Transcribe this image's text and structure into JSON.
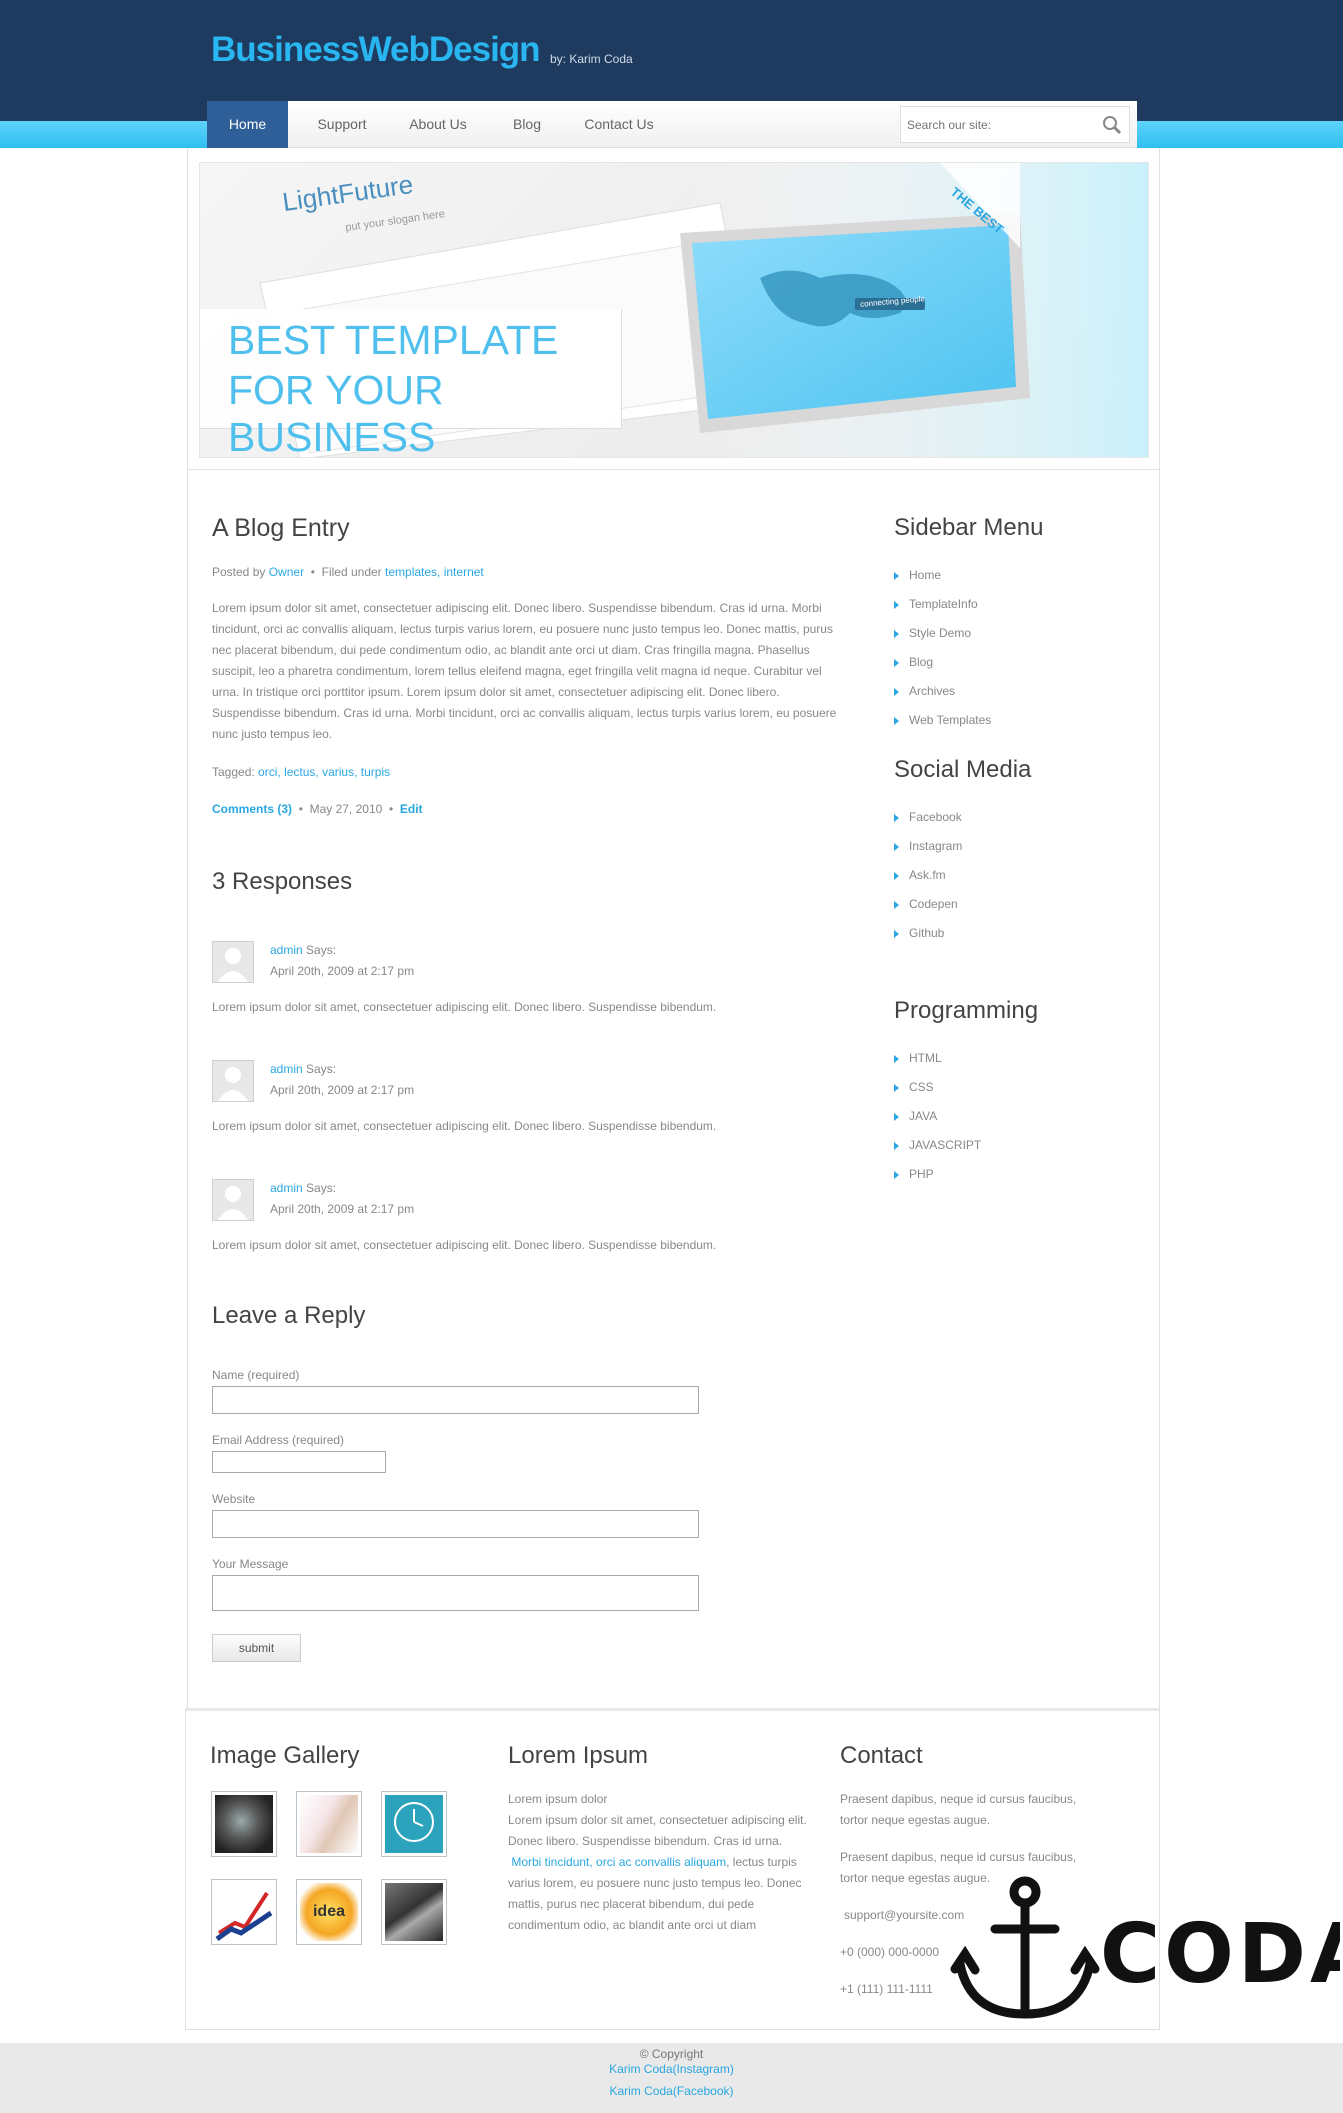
{
  "header": {
    "logo": "BusinessWebDesign",
    "byline": "by: Karim Coda"
  },
  "nav": {
    "items": [
      "Home",
      "Support",
      "About Us",
      "Blog",
      "Contact Us"
    ],
    "search_placeholder": "Search our site:"
  },
  "banner": {
    "brand": "LightFuture",
    "slogan": "put your slogan here",
    "headline_line1": "BEST TEMPLATE",
    "headline_line2": "FOR YOUR BUSINESS",
    "ribbon": "THE BEST",
    "screen_label": "connecting people"
  },
  "post": {
    "title": "A Blog Entry",
    "posted_by": "Posted by",
    "author": "Owner",
    "filed_under": "Filed under",
    "category1": "templates",
    "category2": "internet",
    "body": "Lorem ipsum dolor sit amet, consectetuer adipiscing elit. Donec libero. Suspendisse bibendum. Cras id urna. Morbi tincidunt, orci ac convallis aliquam, lectus turpis varius lorem, eu posuere nunc justo tempus leo. Donec mattis, purus nec placerat bibendum, dui pede condimentum odio, ac blandit ante orci ut diam. Cras fringilla magna. Phasellus suscipit, leo a pharetra condimentum, lorem tellus eleifend magna, eget fringilla velit magna id neque. Curabitur vel urna. In tristique orci porttitor ipsum. Lorem ipsum dolor sit amet, consectetuer adipiscing elit. Donec libero. Suspendisse bibendum. Cras id urna. Morbi tincidunt, orci ac convallis aliquam, lectus turpis varius lorem, eu posuere nunc justo tempus leo.",
    "tagged_label": "Tagged:",
    "tags": [
      "orci",
      "lectus",
      "varius",
      "turpis"
    ],
    "comments_link": "Comments (3)",
    "date": "May 27, 2010",
    "edit": "Edit"
  },
  "responses": {
    "title": "3 Responses",
    "items": [
      {
        "author": "admin",
        "says": "Says:",
        "date": "April 20th, 2009 at 2:17 pm",
        "text": "Lorem ipsum dolor sit amet, consectetuer adipiscing elit. Donec libero. Suspendisse bibendum."
      },
      {
        "author": "admin",
        "says": "Says:",
        "date": "April 20th, 2009 at 2:17 pm",
        "text": "Lorem ipsum dolor sit amet, consectetuer adipiscing elit. Donec libero. Suspendisse bibendum."
      },
      {
        "author": "admin",
        "says": "Says:",
        "date": "April 20th, 2009 at 2:17 pm",
        "text": "Lorem ipsum dolor sit amet, consectetuer adipiscing elit. Donec libero. Suspendisse bibendum."
      }
    ]
  },
  "reply": {
    "title": "Leave a Reply",
    "name_label": "Name (required)",
    "email_label": "Email Address (required)",
    "website_label": "Website",
    "message_label": "Your Message",
    "submit": "submit"
  },
  "sidebar": {
    "menu_title": "Sidebar Menu",
    "menu": [
      "Home",
      "TemplateInfo",
      "Style Demo",
      "Blog",
      "Archives",
      "Web Templates"
    ],
    "social_title": "Social Media",
    "social": [
      "Facebook",
      "Instagram",
      "Ask.fm",
      "Codepen",
      "Github"
    ],
    "prog_title": "Programming",
    "prog": [
      "HTML",
      "CSS",
      "JAVA",
      "JAVASCRIPT",
      "PHP"
    ]
  },
  "footer": {
    "gallery_title": "Image Gallery",
    "lorem_title": "Lorem Ipsum",
    "lorem_line1": "Lorem ipsum dolor",
    "lorem_line2": "Lorem ipsum dolor sit amet, consectetuer adipiscing elit.",
    "lorem_line3": "Donec libero. Suspendisse bibendum. Cras id urna.",
    "lorem_link": "Morbi tincidunt, orci ac convallis aliquam",
    "lorem_line4_tail": ", lectus turpis",
    "lorem_line5": "varius lorem, eu posuere nunc justo tempus leo. Donec",
    "lorem_line6": "mattis, purus nec placerat bibendum, dui pede",
    "lorem_line7": "condimentum odio, ac blandit ante orci ut diam",
    "contact_title": "Contact",
    "contact_p1_l1": "Praesent dapibus, neque id cursus faucibus,",
    "contact_p1_l2": "tortor neque egestas augue.",
    "contact_p2_l1": "Praesent dapibus, neque id cursus faucibus,",
    "contact_p2_l2": "tortor neque egestas augue.",
    "email": "support@yoursite.com",
    "phone1": "+0 (000) 000-0000",
    "phone2": "+1 (111) 111-1111",
    "copyright": "© Copyright",
    "instagram": "Karim Coda(Instagram)",
    "facebook": "Karim Coda(Facebook)",
    "watermark": "CODA"
  },
  "colors": {
    "header_bg": "#1e3a5e",
    "accent": "#29b6f0",
    "link": "#29a7e1",
    "nav_active": "#2f5f98"
  }
}
